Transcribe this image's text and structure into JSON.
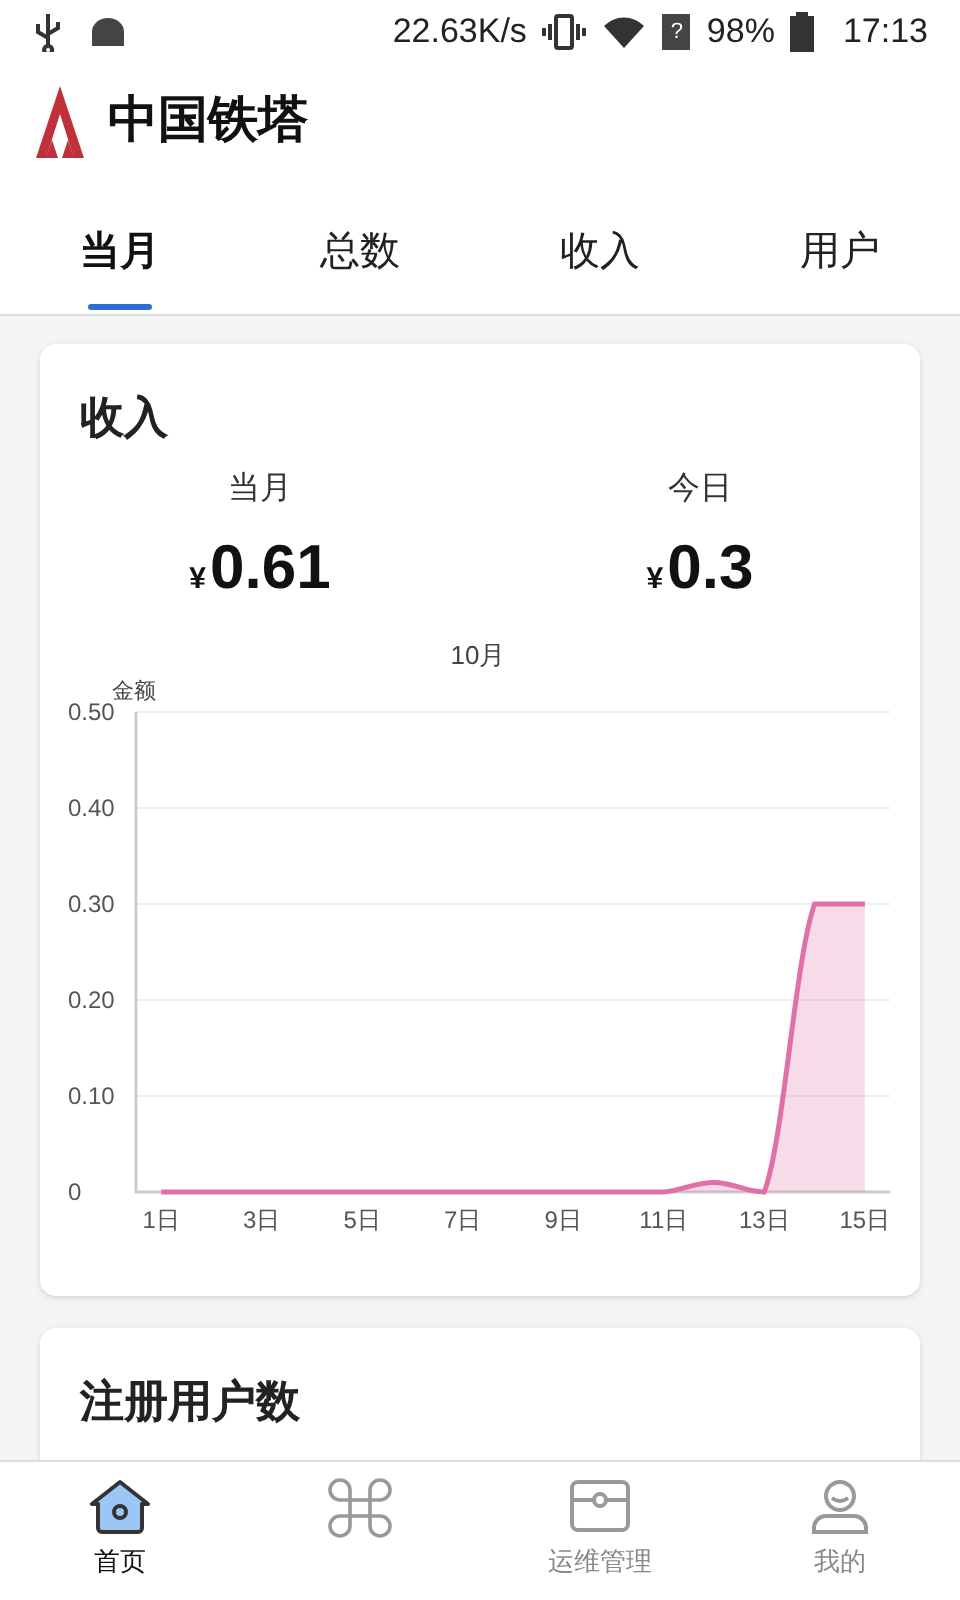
{
  "status_bar": {
    "speed": "22.63K/s",
    "sim_mark": "?",
    "battery": "98%",
    "time": "17:13"
  },
  "app_bar": {
    "title": "中国铁塔"
  },
  "tabs": [
    {
      "label": "当月",
      "selected": true
    },
    {
      "label": "总数",
      "selected": false
    },
    {
      "label": "收入",
      "selected": false
    },
    {
      "label": "用户",
      "selected": false
    }
  ],
  "income_card": {
    "title": "收入",
    "stats": [
      {
        "label": "当月",
        "currency": "¥",
        "value": "0.61"
      },
      {
        "label": "今日",
        "currency": "¥",
        "value": "0.3"
      }
    ],
    "chart_data": {
      "type": "area",
      "title": "10月",
      "ylabel": "金额",
      "x": [
        1,
        2,
        3,
        4,
        5,
        6,
        7,
        8,
        9,
        10,
        11,
        12,
        13,
        14,
        15
      ],
      "xlim": [
        0.5,
        15.5
      ],
      "grid": true,
      "series": [
        {
          "color": "#e070a8",
          "values": [
            0,
            0,
            0,
            0,
            0,
            0,
            0,
            0,
            0,
            0,
            0,
            0.01,
            0,
            0.3,
            0.3
          ]
        }
      ],
      "ylim": [
        0,
        0.5
      ],
      "yticks": [
        {
          "value": 0,
          "label": "0"
        },
        {
          "value": 0.1,
          "label": "0.10"
        },
        {
          "value": 0.2,
          "label": "0.20"
        },
        {
          "value": 0.3,
          "label": "0.30"
        },
        {
          "value": 0.4,
          "label": "0.40"
        },
        {
          "value": 0.5,
          "label": "0.50"
        }
      ],
      "xticks": [
        {
          "value": 1,
          "label": "1日"
        },
        {
          "value": 3,
          "label": "3日"
        },
        {
          "value": 5,
          "label": "5日"
        },
        {
          "value": 7,
          "label": "7日"
        },
        {
          "value": 9,
          "label": "9日"
        },
        {
          "value": 11,
          "label": "11日"
        },
        {
          "value": 13,
          "label": "13日"
        },
        {
          "value": 15,
          "label": "15日"
        }
      ]
    }
  },
  "users_card": {
    "title": "注册用户数"
  },
  "bottom_nav": [
    {
      "kind": "home",
      "label": "首页",
      "selected": true
    },
    {
      "kind": "clover",
      "selected": false
    },
    {
      "kind": "case",
      "label": "运维管理",
      "selected": false
    },
    {
      "kind": "person",
      "label": "我的",
      "selected": false
    }
  ]
}
